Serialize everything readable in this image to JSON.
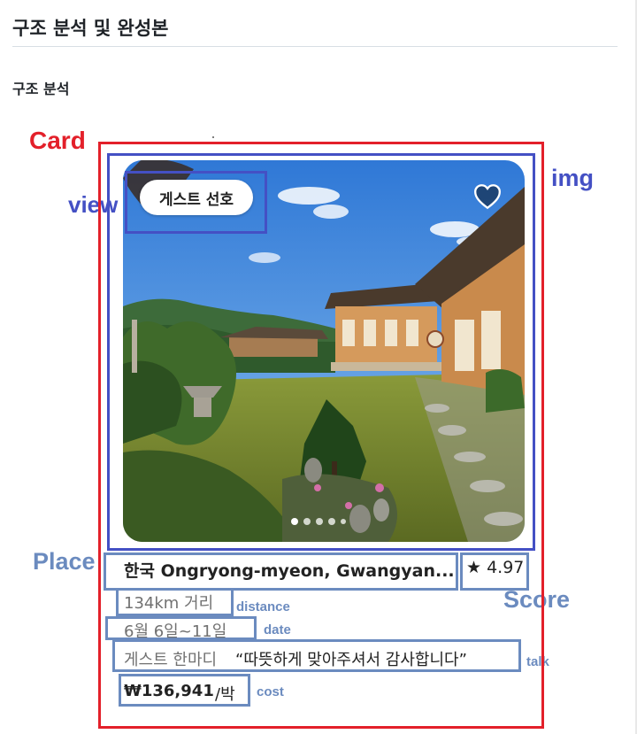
{
  "heading": "구조 분석 및 완성본",
  "subheading": "구조 분석",
  "annotations": {
    "card": "Card",
    "img": "img",
    "view": "view",
    "place": "Place",
    "score": "Score",
    "distance": "distance",
    "date": "date",
    "talk": "talk",
    "cost": "cost"
  },
  "listing": {
    "badge": "게스트 선호",
    "place": "한국 Ongryong-myeon, Gwangyan...",
    "rating": "4.97",
    "distance": "134km 거리",
    "dates": "6월 6일~11일",
    "talk_label": "게스트 한마디",
    "talk_quote": "“따뜻하게 맞아주셔서 감사합니다”",
    "price": "₩136,941",
    "per_night": "/박",
    "photo_count": 5,
    "active_photo": 1
  },
  "colors": {
    "card_frame": "#e3202a",
    "img_frame": "#4450c4",
    "text_frame": "#6b8bbf"
  },
  "icons": [
    "heart-icon",
    "star-icon"
  ]
}
